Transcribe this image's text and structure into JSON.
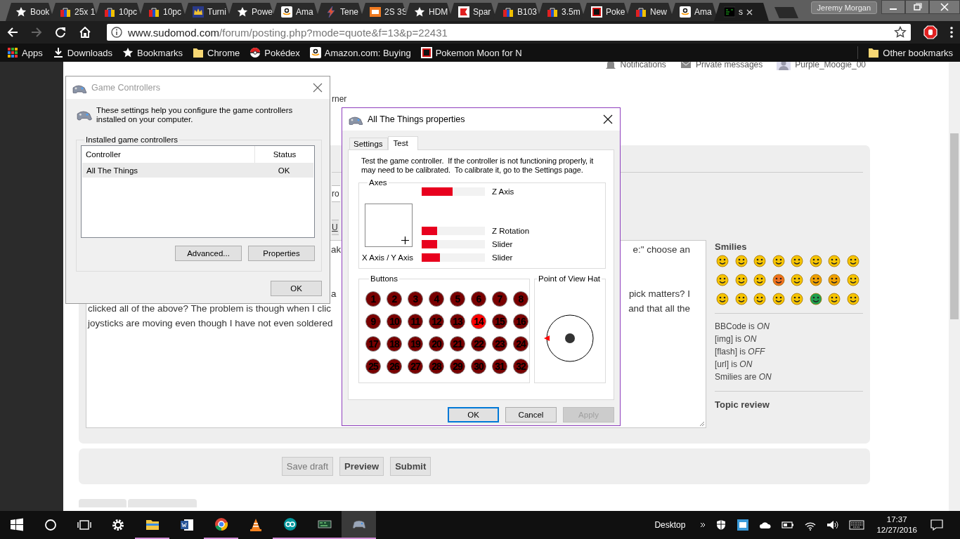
{
  "browser": {
    "tabs": [
      {
        "title": "Book",
        "kind": "star",
        "selected": false
      },
      {
        "title": "25x 1",
        "kind": "bag",
        "selected": false
      },
      {
        "title": "10pc",
        "kind": "bag",
        "selected": false
      },
      {
        "title": "10pc",
        "kind": "bag",
        "selected": false
      },
      {
        "title": "Turni",
        "kind": "crown",
        "selected": false
      },
      {
        "title": "Powe",
        "kind": "star",
        "selected": false
      },
      {
        "title": "Ama",
        "kind": "amazon",
        "selected": false
      },
      {
        "title": "Tene",
        "kind": "bolt",
        "selected": false
      },
      {
        "title": "2S 3S",
        "kind": "orange",
        "selected": false
      },
      {
        "title": "HDM",
        "kind": "star",
        "selected": false
      },
      {
        "title": "Spar",
        "kind": "red",
        "selected": false
      },
      {
        "title": "B103",
        "kind": "bag",
        "selected": false
      },
      {
        "title": "3.5m",
        "kind": "bag",
        "selected": false
      },
      {
        "title": "Poke",
        "kind": "gs",
        "selected": false
      },
      {
        "title": "New",
        "kind": "bag",
        "selected": false
      },
      {
        "title": "Ama",
        "kind": "amazon",
        "selected": false
      },
      {
        "title": "s",
        "kind": "terminal",
        "selected": true
      }
    ],
    "profile": "Jeremy Morgan",
    "url": {
      "host": "www.sudomod.com",
      "path": "/forum/posting.php?mode=quote&f=13&p=22431"
    },
    "bookmarks": [
      {
        "label": "Apps",
        "kind": "apps"
      },
      {
        "label": "Downloads",
        "kind": "download"
      },
      {
        "label": "Bookmarks",
        "kind": "star"
      },
      {
        "label": "Chrome",
        "kind": "folder"
      },
      {
        "label": "Pokédex",
        "kind": "pokeball"
      },
      {
        "label": "Amazon.com: Buying",
        "kind": "amazon"
      },
      {
        "label": "Pokemon Moon for N",
        "kind": "gs"
      }
    ],
    "other_bookmarks": "Other bookmarks"
  },
  "page": {
    "nav": [
      {
        "label": "Notifications",
        "kind": "bell"
      },
      {
        "label": "Private messages",
        "kind": "envelope"
      },
      {
        "label": "Purple_Moogie_00",
        "kind": "avatar"
      }
    ],
    "fragment_top": "rner",
    "fragment_select": "ro",
    "fragment_button": "U",
    "editor_lines": [
      {
        "kind": "partial",
        "left": "ak",
        "right": "e:\" choose an"
      },
      {
        "kind": "blank"
      },
      {
        "kind": "blank"
      },
      {
        "kind": "partial",
        "left": "a",
        "right": "pick matters? I"
      },
      {
        "kind": "full",
        "left": "clicked all of the above? The problem is though when I clic",
        "right": "and that all the"
      },
      {
        "kind": "full",
        "left": "joysticks are moving even though I have not even soldered"
      }
    ],
    "sidebar": {
      "title": "Smilies",
      "smilies": [
        {
          "color": "#f6c400"
        },
        {
          "color": "#f6c400"
        },
        {
          "color": "#f6c400"
        },
        {
          "color": "#f6c400"
        },
        {
          "color": "#f6c400"
        },
        {
          "color": "#f6c400"
        },
        {
          "color": "#f6c400"
        },
        {
          "color": "#f6c400"
        },
        {
          "color": "#f6c400"
        },
        {
          "color": "#f6c400"
        },
        {
          "color": "#f6c400"
        },
        {
          "color": "#f07020"
        },
        {
          "color": "#f6c400"
        },
        {
          "color": "#f0a000"
        },
        {
          "color": "#f0a000"
        },
        {
          "color": "#f6c400"
        },
        {
          "color": "#f6c400"
        },
        {
          "color": "#f6c400"
        },
        {
          "color": "#f6c400"
        },
        {
          "color": "#f6c400"
        },
        {
          "color": "#f6c400"
        },
        {
          "color": "#20a050"
        },
        {
          "color": "#f6c400"
        },
        {
          "color": "#f6c400"
        }
      ],
      "settings": [
        "BBCode is *ON*",
        "[img] is *ON*",
        "[flash] is *OFF*",
        "[url] is *ON*",
        "Smilies are *ON*"
      ],
      "topic_review": "Topic review"
    },
    "actions": [
      {
        "label": "Save draft",
        "kind": "secondary"
      },
      {
        "label": "Preview",
        "kind": "primary"
      },
      {
        "label": "Submit",
        "kind": "primary"
      }
    ]
  },
  "game_controllers": {
    "title": "Game Controllers",
    "active": false,
    "intro": "These settings help you configure the game controllers installed on your computer.",
    "group": "Installed game controllers",
    "columns": [
      "Controller",
      "Status"
    ],
    "rows": [
      {
        "controller": "All The Things",
        "status": "OK",
        "selected": true
      }
    ],
    "buttons": [
      "Advanced...",
      "Properties"
    ],
    "ok": "OK"
  },
  "properties": {
    "title": "All The Things properties",
    "active": true,
    "tabs": [
      {
        "label": "Settings",
        "selected": false
      },
      {
        "label": "Test",
        "selected": true
      }
    ],
    "intro": "Test the game controller.  If the controller is not functioning properly, it may need to be calibrated.  To calibrate it, go to the Settings page.",
    "axes": {
      "title": "Axes",
      "xy_label": "X Axis / Y Axis",
      "bars": [
        {
          "label": "Z Axis",
          "level": 0.49
        },
        {
          "label": "Z Rotation",
          "level": 0.24
        },
        {
          "label": "Slider",
          "level": 0.24
        },
        {
          "label": "Slider",
          "level": 0.29
        }
      ]
    },
    "buttons_title": "Buttons",
    "buttons": [
      {
        "label": "1",
        "pressed": false
      },
      {
        "label": "2",
        "pressed": false
      },
      {
        "label": "3",
        "pressed": false
      },
      {
        "label": "4",
        "pressed": false
      },
      {
        "label": "5",
        "pressed": false
      },
      {
        "label": "6",
        "pressed": false
      },
      {
        "label": "7",
        "pressed": false
      },
      {
        "label": "8",
        "pressed": false
      },
      {
        "label": "9",
        "pressed": false
      },
      {
        "label": "10",
        "pressed": false
      },
      {
        "label": "11",
        "pressed": false
      },
      {
        "label": "12",
        "pressed": false
      },
      {
        "label": "13",
        "pressed": false
      },
      {
        "label": "14",
        "pressed": true
      },
      {
        "label": "15",
        "pressed": false
      },
      {
        "label": "16",
        "pressed": false
      },
      {
        "label": "17",
        "pressed": false
      },
      {
        "label": "18",
        "pressed": false
      },
      {
        "label": "19",
        "pressed": false
      },
      {
        "label": "20",
        "pressed": false
      },
      {
        "label": "21",
        "pressed": false
      },
      {
        "label": "22",
        "pressed": false
      },
      {
        "label": "23",
        "pressed": false
      },
      {
        "label": "24",
        "pressed": false
      },
      {
        "label": "25",
        "pressed": false
      },
      {
        "label": "26",
        "pressed": false
      },
      {
        "label": "27",
        "pressed": false
      },
      {
        "label": "28",
        "pressed": false
      },
      {
        "label": "29",
        "pressed": false
      },
      {
        "label": "30",
        "pressed": false
      },
      {
        "label": "31",
        "pressed": false
      },
      {
        "label": "32",
        "pressed": false
      }
    ],
    "pov": {
      "title": "Point of View Hat",
      "pointing_west": true
    },
    "dialog_buttons": [
      {
        "label": "OK",
        "kind": "default",
        "disabled": false
      },
      {
        "label": "Cancel",
        "kind": "normal",
        "disabled": false
      },
      {
        "label": "Apply",
        "kind": "normal",
        "disabled": true
      }
    ]
  },
  "taskbar": {
    "apps": [
      {
        "kind": "explorer",
        "running": true,
        "selected": false
      },
      {
        "kind": "word",
        "running": false,
        "selected": false
      },
      {
        "kind": "chrome",
        "running": true,
        "selected": false
      },
      {
        "kind": "vlc",
        "running": false,
        "selected": false
      },
      {
        "kind": "arduino",
        "running": true,
        "selected": false
      },
      {
        "kind": "board",
        "running": true,
        "selected": false
      },
      {
        "kind": "gamepad",
        "running": true,
        "selected": true
      }
    ],
    "desktop": "Desktop",
    "time": "17:37",
    "date": "12/27/2016"
  }
}
